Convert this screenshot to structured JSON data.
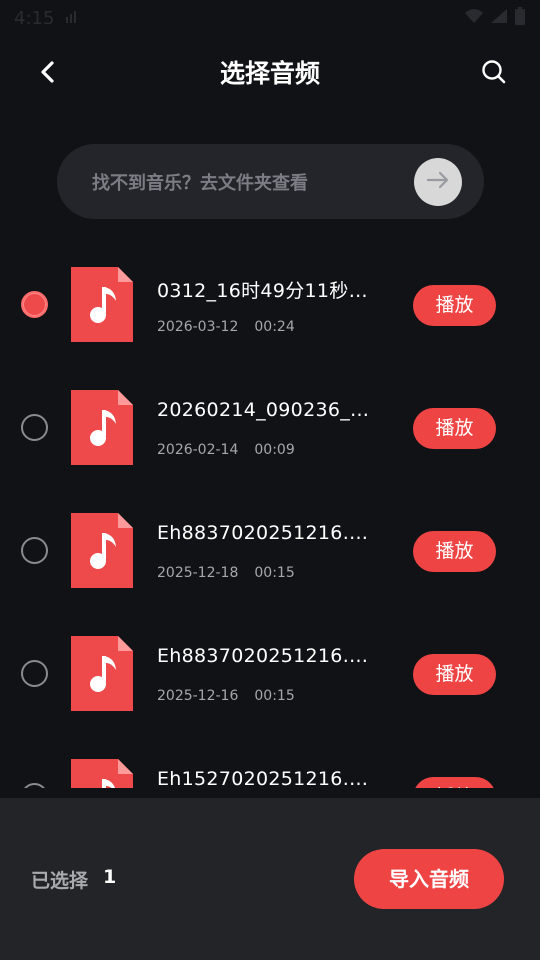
{
  "status_bar": {
    "time": "4:15",
    "icons": [
      "signal-small-icon",
      "wifi-icon",
      "cellular-icon",
      "battery-icon"
    ]
  },
  "header": {
    "title": "选择音频",
    "back_icon": "chevron-left-icon",
    "search_icon": "search-icon"
  },
  "folder_bar": {
    "text": "找不到音乐？去文件夹查看",
    "icon": "arrow-right-icon"
  },
  "files": [
    {
      "name": "0312_16时49分11秒…",
      "date": "2026-03-12",
      "duration": "00:24",
      "selected": true,
      "play_label": "播放"
    },
    {
      "name": "20260214_090236_…",
      "date": "2026-02-14",
      "duration": "00:09",
      "selected": false,
      "play_label": "播放"
    },
    {
      "name": "Eh8837020251216.…",
      "date": "2025-12-18",
      "duration": "00:15",
      "selected": false,
      "play_label": "播放"
    },
    {
      "name": "Eh8837020251216.…",
      "date": "2025-12-16",
      "duration": "00:15",
      "selected": false,
      "play_label": "播放"
    },
    {
      "name": "Eh1527020251216.…",
      "date": "",
      "duration": "",
      "selected": false,
      "play_label": "播放"
    }
  ],
  "bottom": {
    "selected_label": "已选择",
    "selected_count": "1",
    "import_label": "导入音频"
  },
  "colors": {
    "accent": "#ef4444",
    "background": "#111216",
    "panel": "#23252a"
  }
}
